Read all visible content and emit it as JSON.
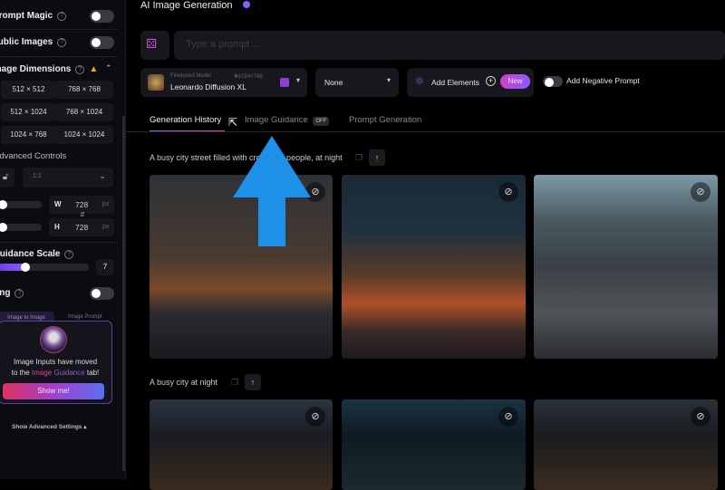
{
  "sidebar": {
    "prompt_magic": "Prompt Magic",
    "public_images": "Public Images",
    "image_dimensions": "Image Dimensions",
    "dimensions": [
      "512 × 512",
      "768 × 768",
      "512 × 1024",
      "768 × 1024",
      "1024 × 768",
      "1024 × 1024"
    ],
    "advanced_controls": "Advanced Controls",
    "aspect_ratio": "1:1",
    "width_label": "W",
    "width_value": "728",
    "height_label": "H",
    "height_value": "728",
    "unit": "px",
    "guidance_scale": "Guidance Scale",
    "guidance_value": "7",
    "guidance_fraction": 0.25,
    "tiling": "Tiling",
    "tabs": [
      "Image to Image",
      "Image Prompt"
    ],
    "notice_line1": "Image Inputs have moved",
    "notice_line2_pre": "to the",
    "notice_link": "Image Guidance",
    "notice_line2_post": "tab!",
    "show_me": "Show me!",
    "show_advanced": "Show Advanced Settings"
  },
  "header": {
    "title": "AI Image Generation",
    "prompt_placeholder": "Type a prompt ..."
  },
  "toolbar": {
    "model_tag": "Finetuned Model",
    "model_res": "1024×768",
    "model_name": "Leonardo Diffusion XL",
    "style": "None",
    "add_elements": "Add Elements",
    "new_badge": "New",
    "negative_prompt": "Add Negative Prompt"
  },
  "tabs": [
    {
      "label": "Generation History",
      "active": true
    },
    {
      "label": "Image Guidance",
      "badge": "OFF"
    },
    {
      "label": "Prompt Generation"
    }
  ],
  "generations": [
    {
      "prompt": "A busy city street filled with crowds of people, at night"
    },
    {
      "prompt": "A busy city at night"
    }
  ],
  "colors": {
    "accent": "#8b5cf6",
    "arrow": "#1e90e8",
    "warning": "#f5a623"
  }
}
